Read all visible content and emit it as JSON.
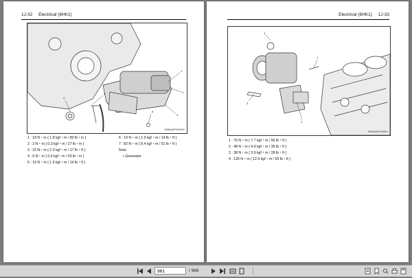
{
  "viewer": {
    "current_page": "961",
    "page_total": "/ 966",
    "icons": [
      "first-page-icon",
      "prev-page-icon",
      "next-page-icon",
      "last-page-icon",
      "fit-width-icon",
      "fit-page-icon",
      "thumbnails-icon",
      "bookmark-icon",
      "search-icon",
      "print-icon",
      "save-icon"
    ]
  },
  "left_page": {
    "page_number": "1J-32",
    "section": "Electrical (6HK1)",
    "figure_code": "RXSW1AHF000401",
    "torque_col1": [
      "1 :  18 N・m { 1.8 kgf・m / 80 lb・in }",
      "2 :  3 N・m { 0.3 kgf・m / 27 lb・in }",
      "3 :  23 N・m { 2.3 kgf・m / 17 lb・ft }",
      "4 :  6 N・m { 0.6 kgf・m / 53 lb・in }",
      "5 :  19 N・m { 1.9 kgf・m / 14 lb・ft }"
    ],
    "torque_col2": [
      "6 :  19 N・m { 1.9 kgf・m / 14 lb・ft }",
      "7 :  82 N・m { 8.4 kgf・m / 61 lb・ft }"
    ],
    "note_title": "Note",
    "note_item": "Generator"
  },
  "right_page": {
    "page_number": "1J-33",
    "section": "Electrical (6HK1)",
    "figure_code": "RXSW1AHF000501",
    "torque": [
      "1 :  76 N・m { 7.7 kgf・m / 56 lb・ft }",
      "2 :  48 N・m { 4.9 kgf・m / 35 lb・ft }",
      "3 :  38 N・m { 3.9 kgf・m / 28 lb・ft }",
      "4 :  126 N・m { 12.9 kgf・m / 93 lb・ft }"
    ]
  }
}
